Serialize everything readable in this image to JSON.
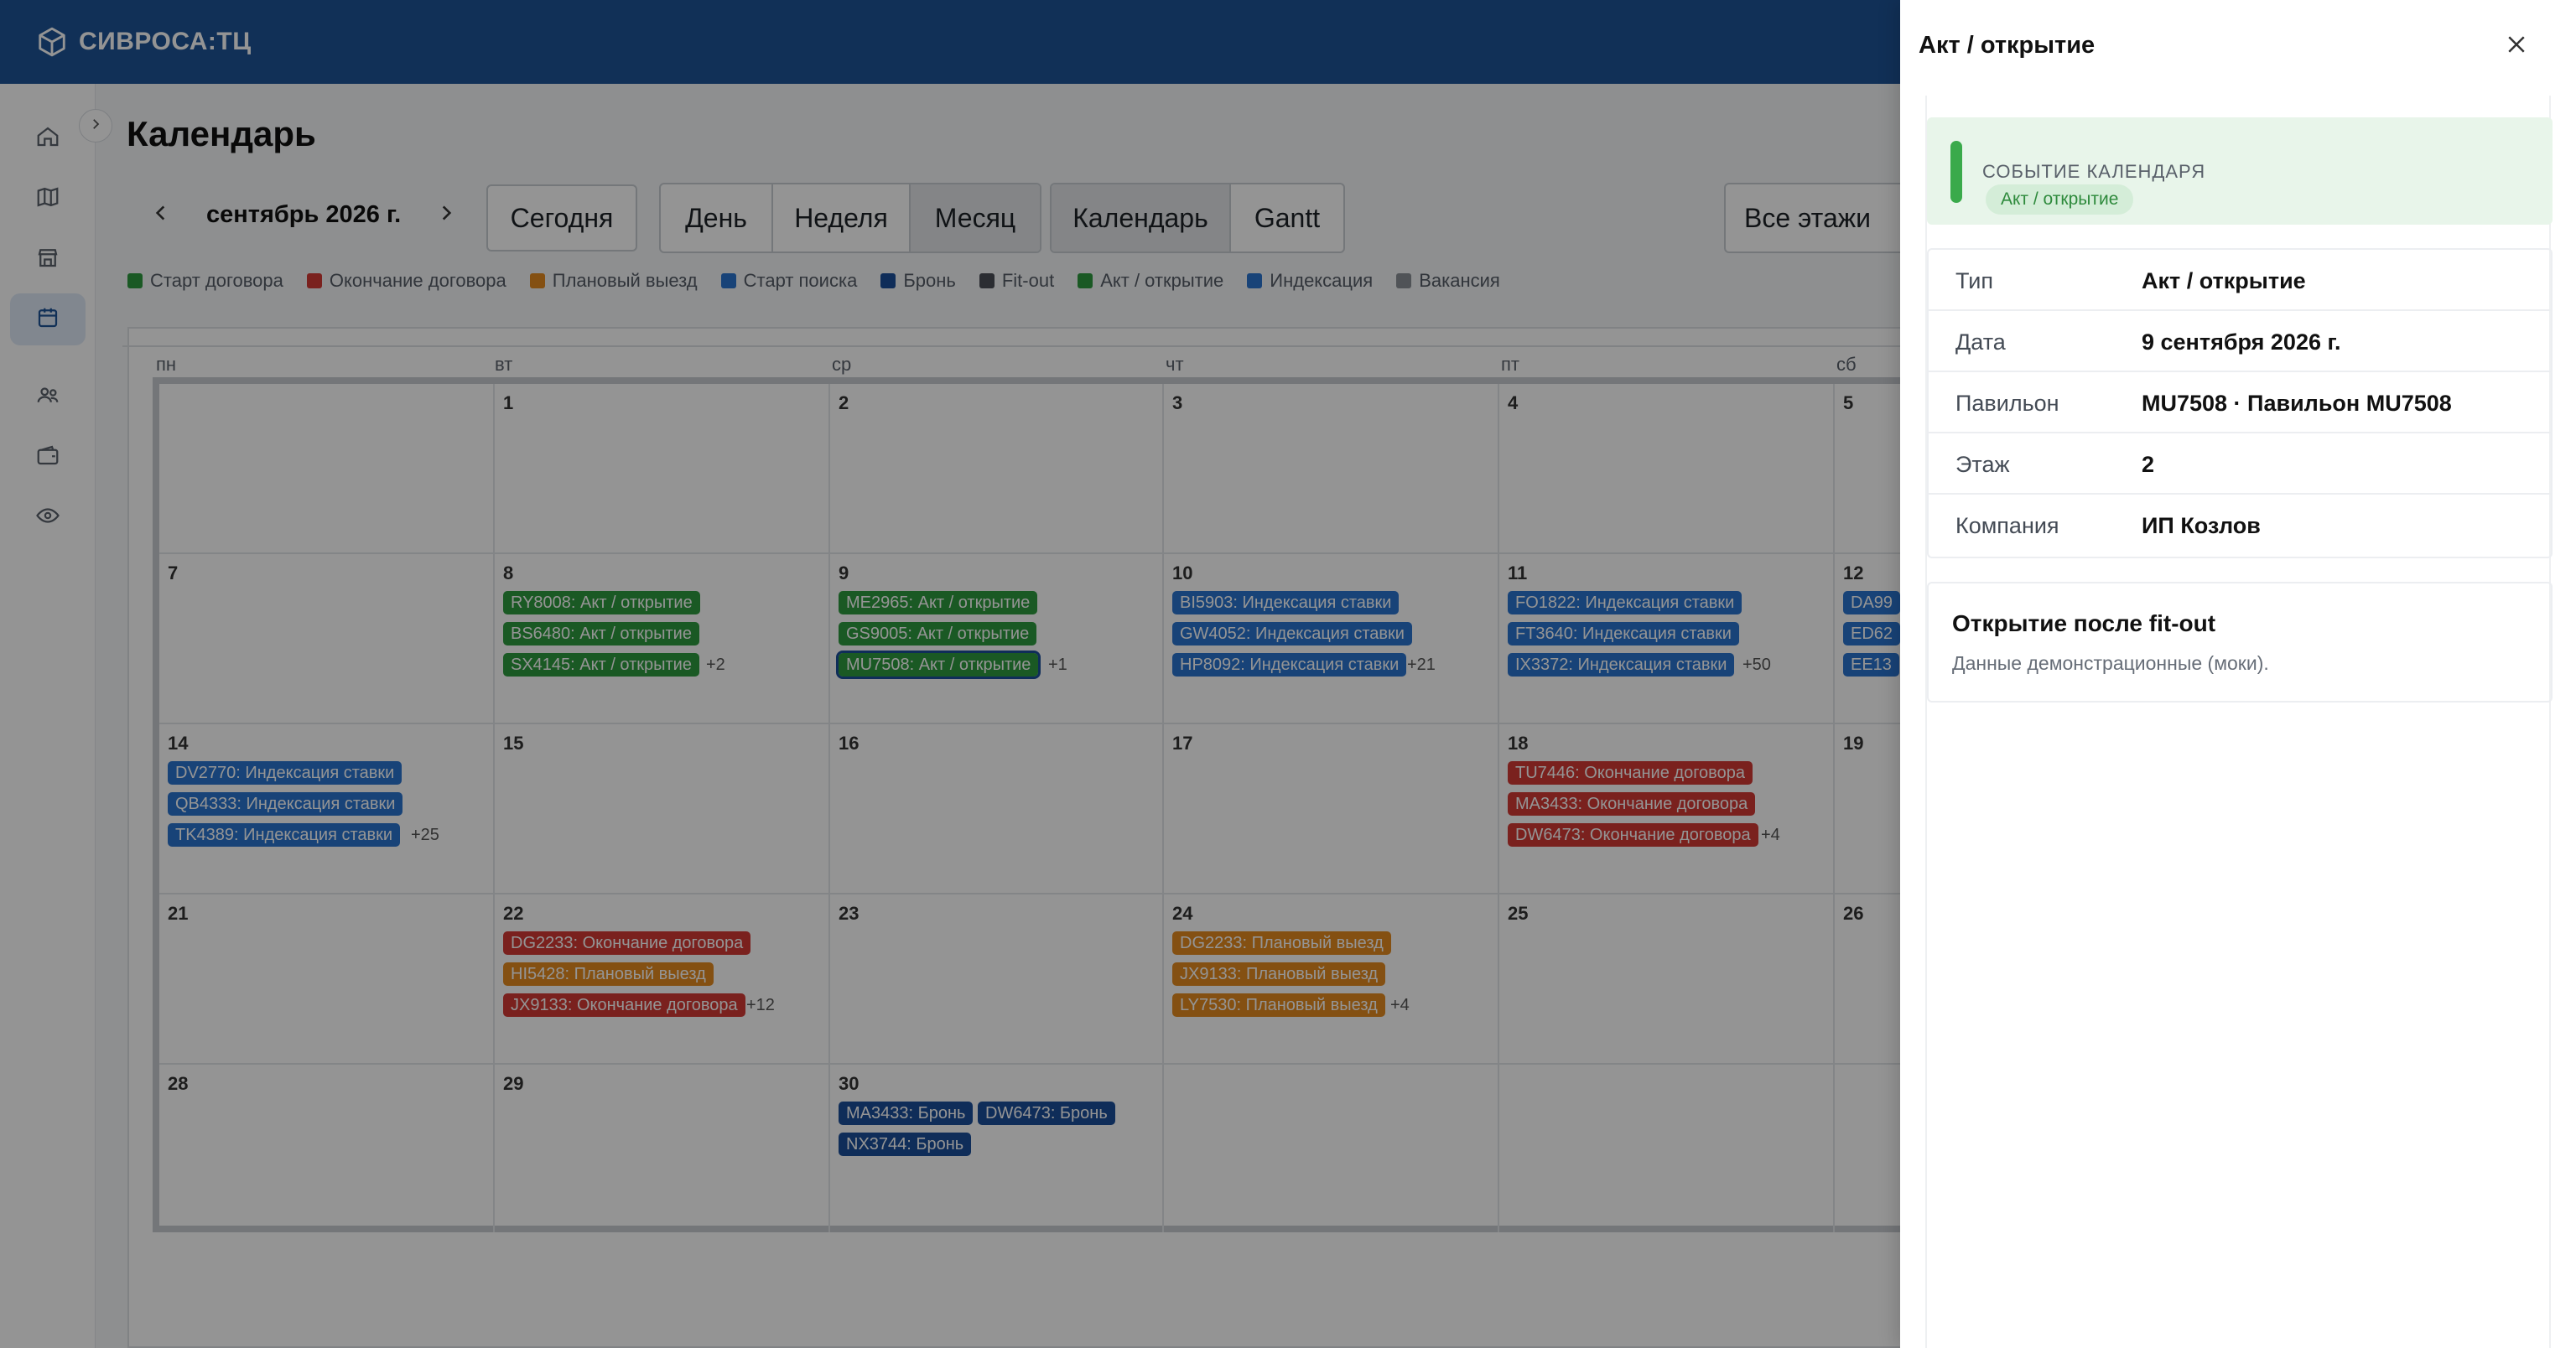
{
  "app": {
    "brand": "СИВРОСА:ТЦ"
  },
  "page": {
    "title": "Календарь"
  },
  "toolbar": {
    "month": "сентябрь 2026 г.",
    "today": "Сегодня",
    "views": [
      "День",
      "Неделя",
      "Месяц"
    ],
    "modes": [
      "Календарь",
      "Gantt"
    ],
    "floor": "Все этажи"
  },
  "legend": [
    {
      "label": "Старт договора",
      "color": "#2e9a3e"
    },
    {
      "label": "Окончание договора",
      "color": "#d23a35"
    },
    {
      "label": "Плановый выезд",
      "color": "#e38a1f"
    },
    {
      "label": "Старт поиска",
      "color": "#2a74cf"
    },
    {
      "label": "Бронь",
      "color": "#1b4f9a"
    },
    {
      "label": "Fit-out",
      "color": "#4a4f57"
    },
    {
      "label": "Акт / открытие",
      "color": "#2e9a3e"
    },
    {
      "label": "Индексация",
      "color": "#2a74cf"
    },
    {
      "label": "Вакансия",
      "color": "#8a8f96"
    }
  ],
  "weekdays": [
    "пн",
    "вт",
    "ср",
    "чт",
    "пт",
    "сб"
  ],
  "calendar": {
    "days": {
      "d1": "1",
      "d2": "2",
      "d3": "3",
      "d4": "4",
      "d5": "5",
      "d7": "7",
      "d8": "8",
      "d9": "9",
      "d10": "10",
      "d11": "11",
      "d12": "12",
      "d14": "14",
      "d15": "15",
      "d16": "16",
      "d17": "17",
      "d18": "18",
      "d19": "19",
      "d21": "21",
      "d22": "22",
      "d23": "23",
      "d24": "24",
      "d25": "25",
      "d26": "26",
      "d28": "28",
      "d29": "29",
      "d30": "30"
    },
    "events": {
      "e8": [
        "RY8008: Акт / открытие",
        "BS6480: Акт / открытие",
        "SX4145: Акт / открытие"
      ],
      "m8": "+2",
      "e9": [
        "ME2965: Акт / открытие",
        "GS9005: Акт / открытие",
        "MU7508: Акт / открытие"
      ],
      "m9": "+1",
      "e10": [
        "BI5903: Индексация ставки",
        "GW4052: Индексация ставки",
        "HP8092: Индексация ставки"
      ],
      "m10": "+21",
      "e11": [
        "FO1822: Индексация ставки",
        "FT3640: Индексация ставки",
        "IX3372: Индексация ставки"
      ],
      "m11": "+50",
      "e12": [
        "DA99",
        "ED62",
        "EE13"
      ],
      "e14": [
        "DV2770: Индексация ставки",
        "QB4333: Индексация ставки",
        "TK4389: Индексация ставки"
      ],
      "m14": "+25",
      "e18": [
        "TU7446: Окончание договора",
        "MA3433: Окончание договора",
        "DW6473: Окончание договора"
      ],
      "m18": "+4",
      "e22": [
        "DG2233: Окончание договора",
        "HI5428: Плановый выезд",
        "JX9133: Окончание договора"
      ],
      "m22": "+12",
      "e24": [
        "DG2233: Плановый выезд",
        "JX9133: Плановый выезд",
        "LY7530: Плановый выезд"
      ],
      "m24": "+4",
      "e30": [
        "MA3433: Бронь",
        "DW6473: Бронь",
        "NX3744: Бронь"
      ]
    }
  },
  "drawer": {
    "title": "Акт / открытие",
    "kicker": "СОБЫТИЕ КАЛЕНДАРЯ",
    "chip": "Акт / открытие",
    "rows": [
      {
        "label": "Тип",
        "value": "Акт / открытие"
      },
      {
        "label": "Дата",
        "value": "9 сентября 2026 г."
      },
      {
        "label": "Павильон",
        "value": "MU7508 · Павильон MU7508"
      },
      {
        "label": "Этаж",
        "value": "2"
      },
      {
        "label": "Компания",
        "value": "ИП Козлов"
      }
    ],
    "note_title": "Открытие после fit-out",
    "note_text": "Данные демонстрационные (моки)."
  }
}
